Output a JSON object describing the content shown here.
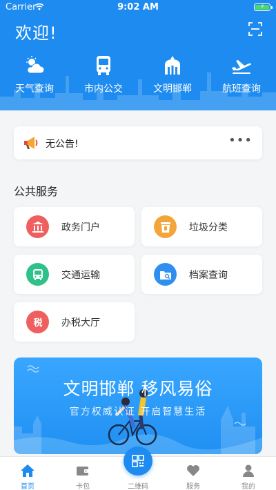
{
  "status_bar": {
    "carrier": "Carrier",
    "time": "9:02 AM"
  },
  "header": {
    "welcome": "欢迎!"
  },
  "quick_links": [
    {
      "label": "天气查询",
      "icon": "weather-icon"
    },
    {
      "label": "市内公交",
      "icon": "bus-icon"
    },
    {
      "label": "文明邯郸",
      "icon": "landmark-icon"
    },
    {
      "label": "航班查询",
      "icon": "airplane-icon"
    }
  ],
  "notice": {
    "text": "无公告!",
    "more": "•••"
  },
  "section": {
    "title": "公共服务"
  },
  "services": [
    {
      "label": "政务门户",
      "icon": "government-icon",
      "color": "#ef5f5f"
    },
    {
      "label": "垃圾分类",
      "icon": "trash-icon",
      "color": "#f4a53a"
    },
    {
      "label": "交通运输",
      "icon": "bus-icon",
      "color": "#2ec28a"
    },
    {
      "label": "档案查询",
      "icon": "archive-icon",
      "color": "#2f8ff0"
    },
    {
      "label": "办税大厅",
      "icon": "tax-icon",
      "color": "#ef5f5f"
    }
  ],
  "banner": {
    "title": "文明邯郸  移风易俗",
    "subtitle": "官方权威认证   开启智慧生活"
  },
  "tabbar": {
    "items": [
      {
        "label": "首页",
        "icon": "home-icon",
        "active": true
      },
      {
        "label": "卡包",
        "icon": "wallet-icon",
        "active": false
      },
      {
        "label": "二维码",
        "icon": "qr-code-icon",
        "active": false
      },
      {
        "label": "服务",
        "icon": "heart-icon",
        "active": false
      },
      {
        "label": "我的",
        "icon": "profile-icon",
        "active": false
      }
    ]
  },
  "colors": {
    "primary": "#1d8bf0",
    "background": "#f4f5f7"
  }
}
